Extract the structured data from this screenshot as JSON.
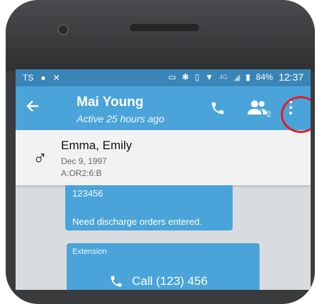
{
  "status_bar": {
    "left_icons": [
      "ts-icon",
      "android-icon",
      "notification-icon"
    ],
    "right_icons": [
      "cast-icon",
      "bluetooth-icon",
      "vibrate-icon",
      "wifi-icon",
      "signal-icon",
      "battery-icon"
    ],
    "network": "4G",
    "battery": "84%",
    "time": "12:37"
  },
  "header": {
    "title": "Mai Young",
    "subtitle": "Active 25 hours ago",
    "group_count": "2"
  },
  "patient": {
    "gender_symbol": "♂",
    "name": "Emma, Emily",
    "dob": "Dec 9, 1997",
    "location": "A:OR2:6:B"
  },
  "messages": [
    {
      "number": "123456",
      "text": "Need discharge orders entered."
    },
    {
      "label": "Extension",
      "action": "Call (123) 456"
    }
  ],
  "colors": {
    "status_bar": "#3a85b8",
    "app_bar": "#4aa3d9",
    "bubble": "#4aa3d9",
    "highlight_circle": "#e21d24"
  }
}
